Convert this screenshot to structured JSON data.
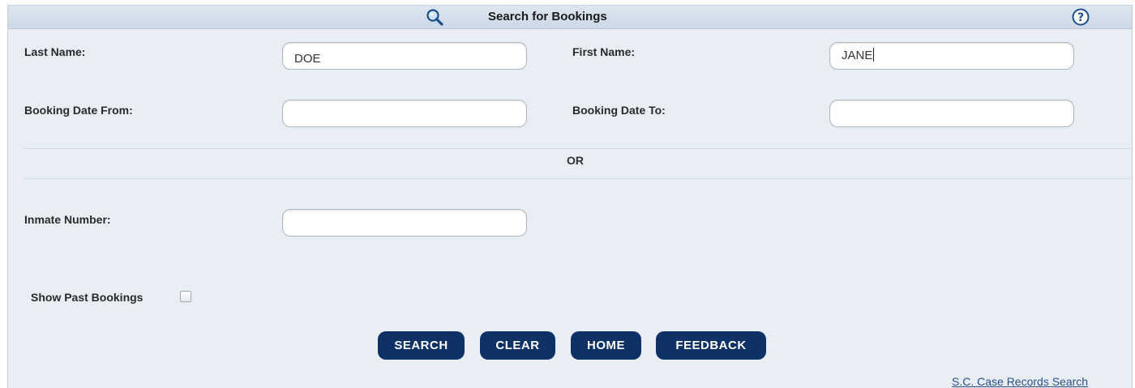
{
  "header": {
    "title": "Search for Bookings",
    "search_icon": "magnifier-icon",
    "help_icon": "help-question-icon"
  },
  "form": {
    "last_name_label": "Last Name:",
    "last_name_value": "DOE",
    "first_name_label": "First Name:",
    "first_name_value": "JANE",
    "booking_date_from_label": "Booking Date From:",
    "booking_date_from_value": "",
    "booking_date_to_label": "Booking Date To:",
    "booking_date_to_value": "",
    "or_label": "OR",
    "inmate_number_label": "Inmate Number:",
    "inmate_number_value": "",
    "show_past_bookings_label": "Show Past Bookings",
    "show_past_bookings_checked": false
  },
  "buttons": {
    "search": "SEARCH",
    "clear": "CLEAR",
    "home": "HOME",
    "feedback": "FEEDBACK"
  },
  "footer": {
    "link": "S.C. Case Records Search"
  },
  "colors": {
    "panel_bg": "#e9eef5",
    "button_bg": "#0f3266",
    "link": "#2a4f8a"
  }
}
